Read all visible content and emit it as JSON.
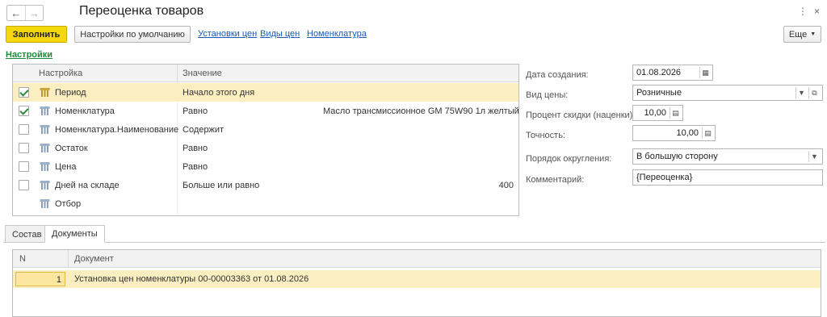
{
  "window": {
    "title": "Переоценка товаров",
    "more_glyph": "⋮",
    "close_glyph": "×"
  },
  "toolbar": {
    "fill_label": "Заполнить",
    "defaults_label": "Настройки по умолчанию",
    "links": [
      "Установки цен",
      "Виды цен",
      "Номенклатура"
    ],
    "more_label": "Еще"
  },
  "settings_section": {
    "link": "Настройки",
    "columns": [
      "Настройка",
      "Значение"
    ],
    "rows": [
      {
        "checked": true,
        "name": "Период",
        "operator": "Начало этого дня",
        "value": "",
        "selected": true
      },
      {
        "checked": true,
        "name": "Номенклатура",
        "operator": "Равно",
        "value": "Масло трансмиссионное GM 75W90 1л желтый",
        "selected": false
      },
      {
        "checked": false,
        "name": "Номенклатура.Наименование",
        "operator": "Содержит",
        "value": "",
        "selected": false
      },
      {
        "checked": false,
        "name": "Остаток",
        "operator": "Равно",
        "value": "",
        "selected": false
      },
      {
        "checked": false,
        "name": "Цена",
        "operator": "Равно",
        "value": "",
        "selected": false
      },
      {
        "checked": false,
        "name": "Дней на складе",
        "operator": "Больше или равно",
        "value": "400",
        "selected": false
      },
      {
        "checked": null,
        "name": "Отбор",
        "operator": "",
        "value": "",
        "selected": false
      }
    ]
  },
  "form": {
    "date_label": "Дата создания:",
    "date_value": "01.08.2026",
    "price_type_label": "Вид цены:",
    "price_type_value": "Розничные",
    "discount_label": "Процент скидки (наценки):",
    "discount_value": "10,00",
    "precision_label": "Точность:",
    "precision_value": "10,00",
    "rounding_label": "Порядок округления:",
    "rounding_value": "В большую сторону",
    "comment_label": "Комментарий:",
    "comment_value": "{Переоценка}"
  },
  "tabs": {
    "items": [
      "Состав",
      "Документы"
    ],
    "active": "Документы"
  },
  "documents": {
    "columns": [
      "N",
      "Документ"
    ],
    "rows": [
      {
        "n": "1",
        "doc": "Установка цен номенклатуры 00-00003363 от 01.08.2026"
      }
    ]
  },
  "colors": {
    "accent_yellow": "#f5d70f",
    "selection": "#fbeec0",
    "link_blue": "#1a5bb5",
    "section_green": "#1d8b3b"
  }
}
